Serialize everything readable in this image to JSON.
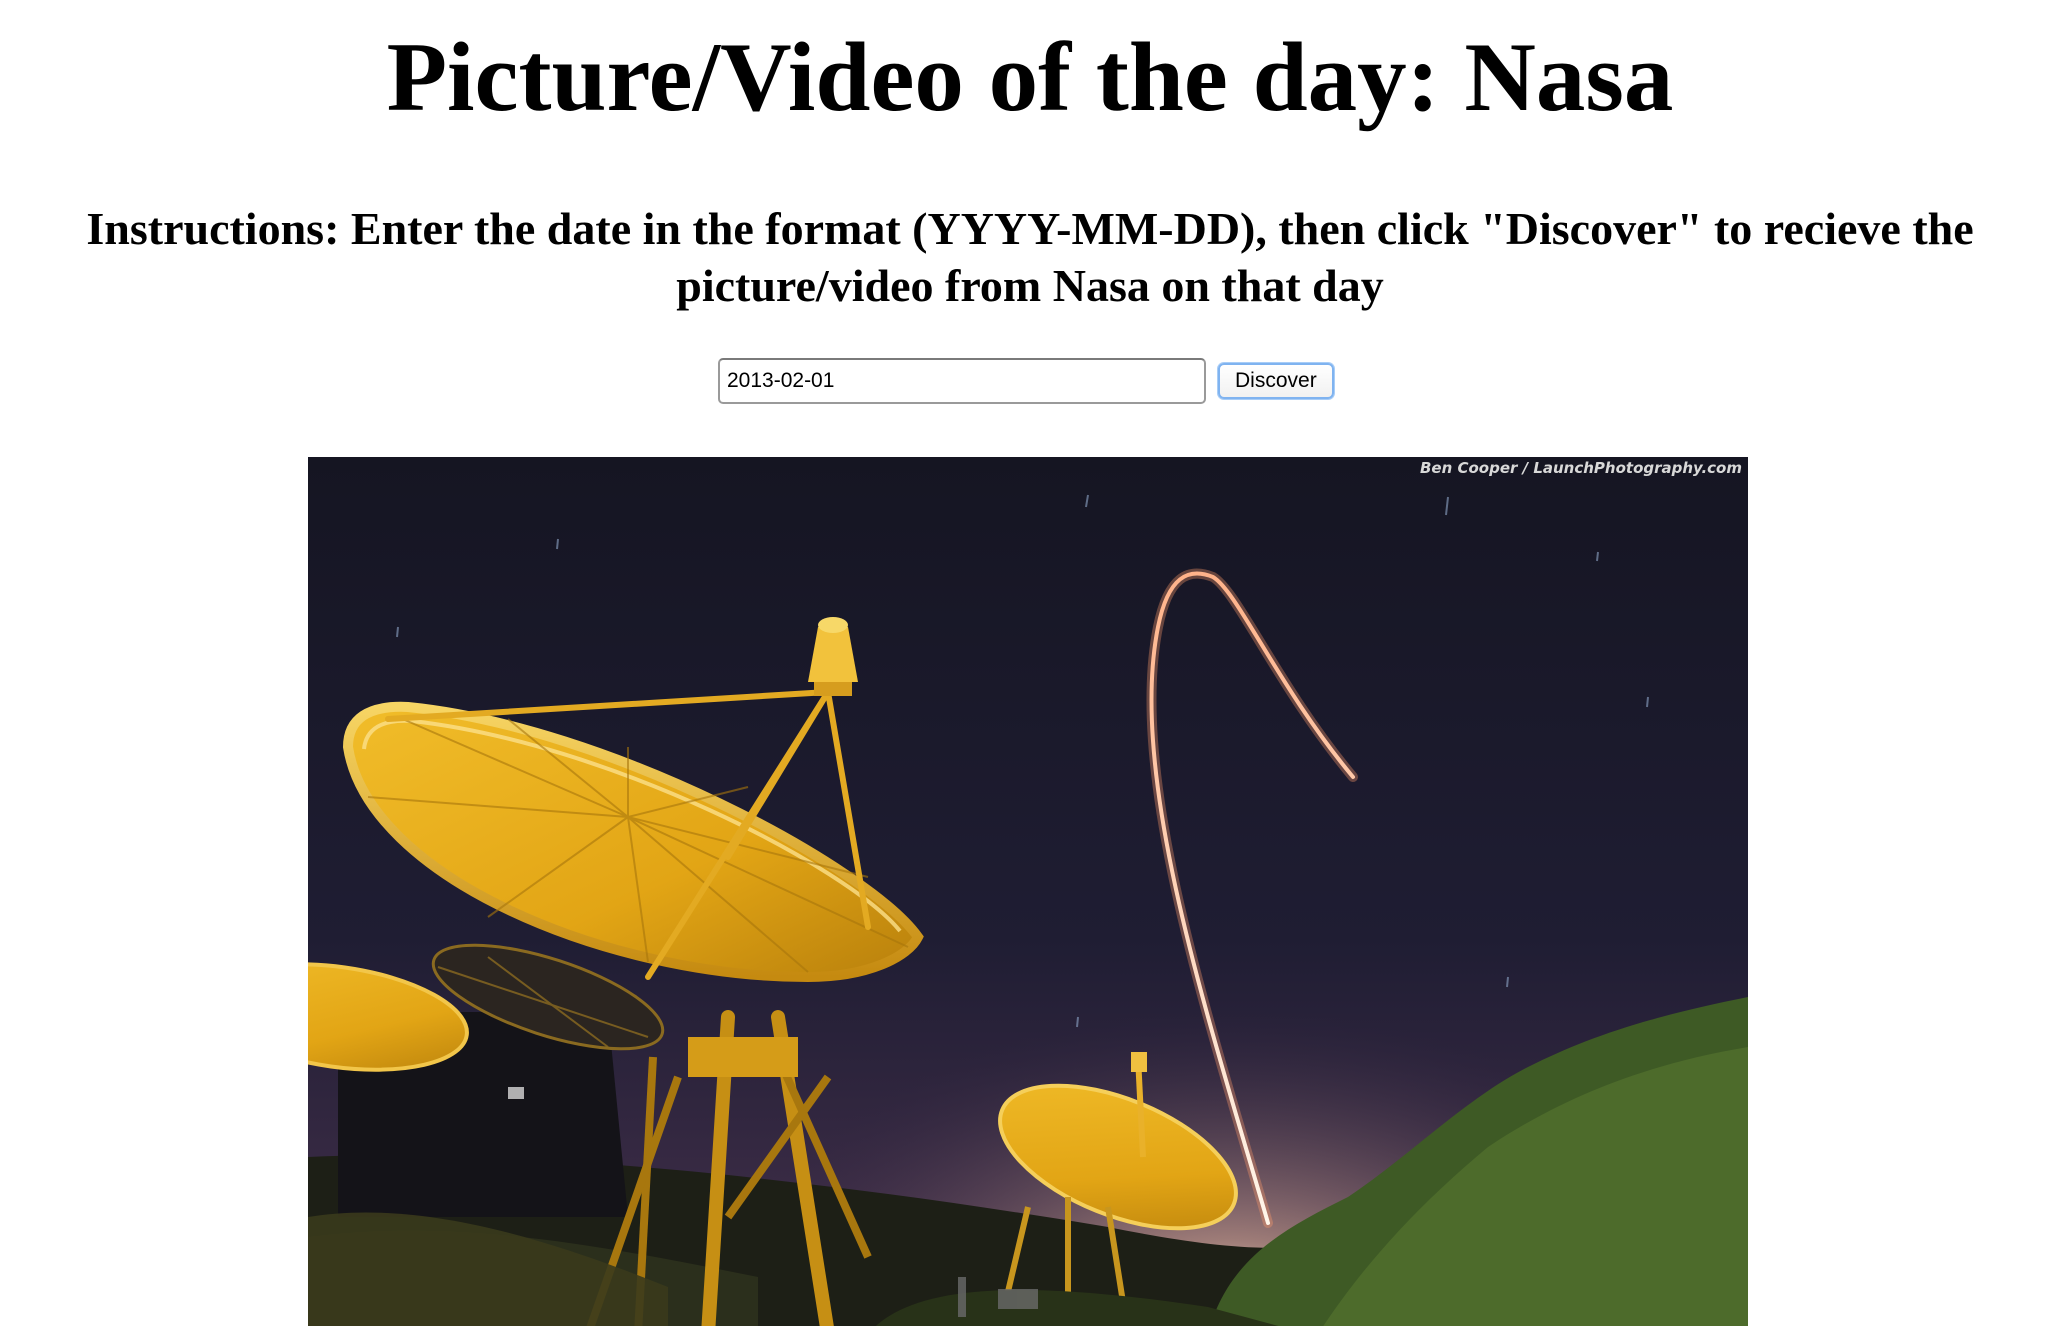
{
  "page": {
    "title": "Picture/Video of the day: Nasa",
    "instructions": "Instructions: Enter the date in the format (YYYY-MM-DD), then click \"Discover\" to recieve the picture/video from Nasa on that day"
  },
  "form": {
    "date_value": "2013-02-01",
    "button_label": "Discover"
  },
  "media": {
    "credit": "Ben Cooper / LaunchPhotography.com"
  }
}
